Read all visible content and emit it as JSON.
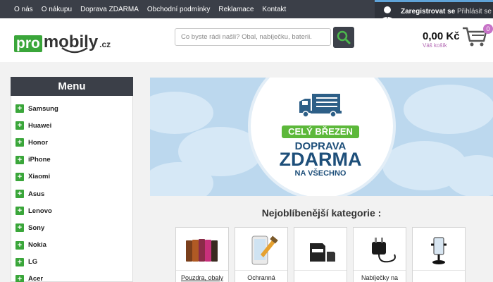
{
  "topnav": [
    "O nás",
    "O nákupu",
    "Doprava ZDARMA",
    "Obchodní podmínky",
    "Reklamace",
    "Kontakt"
  ],
  "user": {
    "register": "Zaregistrovat se",
    "login": "Přihlásit se"
  },
  "logo": {
    "pro": "pro",
    "mobily": "mobily",
    "cz": ".cz"
  },
  "search": {
    "placeholder": "Co byste rádi našli? Obal, nabíječku, baterii."
  },
  "cart": {
    "price": "0,00 Kč",
    "label": "Váš košík",
    "count": "0"
  },
  "menu": {
    "title": "Menu",
    "items": [
      "Samsung",
      "Huawei",
      "Honor",
      "iPhone",
      "Xiaomi",
      "Asus",
      "Lenovo",
      "Sony",
      "Nokia",
      "LG",
      "Acer"
    ]
  },
  "banner": {
    "badge": "CELÝ BŘEZEN",
    "line1": "DOPRAVA",
    "line2": "ZDARMA",
    "line3": "NA VŠECHNO"
  },
  "categories": {
    "title": "Nejoblíbenější kategorie :",
    "items": [
      {
        "label": "Pouzdra, obaly",
        "icon": "cases-icon"
      },
      {
        "label": "Ochranná",
        "icon": "screen-protector-icon"
      },
      {
        "label": "",
        "icon": "memory-card-icon"
      },
      {
        "label": "Nabíječky na",
        "icon": "charger-icon"
      },
      {
        "label": "",
        "icon": "car-holder-icon"
      }
    ]
  },
  "colors": {
    "accent_green": "#3aa63a",
    "dark_bar": "#3b3f48",
    "badge_pink": "#c772c7",
    "banner_blue": "#1e4f7a"
  }
}
